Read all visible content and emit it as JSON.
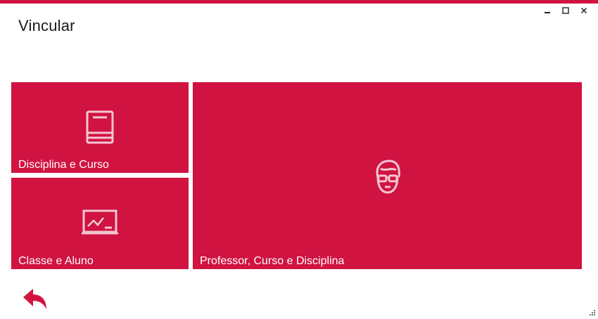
{
  "window": {
    "title": "Vincular",
    "controls": [
      "minimize-icon",
      "maximize-icon",
      "close-icon"
    ],
    "accent_color": "#d01341"
  },
  "tiles": [
    {
      "label": "Disciplina e Curso",
      "icon": "book-icon"
    },
    {
      "label": "Classe e Aluno",
      "icon": "chalkboard-icon"
    },
    {
      "label": "Professor, Curso e Disciplina",
      "icon": "teacher-icon"
    }
  ],
  "footer": {
    "back_icon": "back-arrow-icon",
    "resize_icon": "resize-grip-icon"
  }
}
